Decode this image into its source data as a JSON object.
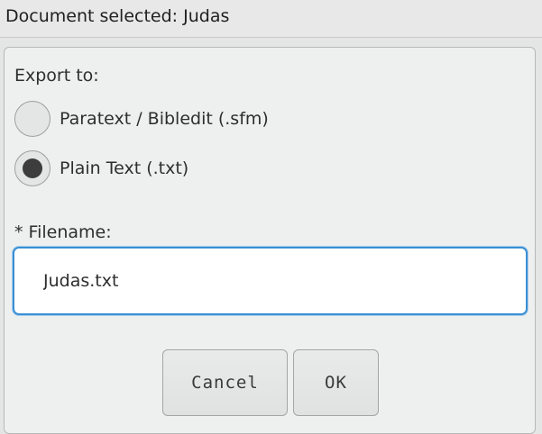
{
  "window": {
    "title": "Document selected: Judas"
  },
  "export": {
    "label": "Export to:",
    "options": [
      {
        "label": "Paratext / Bibledit (.sfm)",
        "selected": false
      },
      {
        "label": "Plain Text (.txt)",
        "selected": true
      }
    ]
  },
  "filename": {
    "label": "* Filename:",
    "value": "Judas.txt"
  },
  "buttons": {
    "cancel_label": "Cancel",
    "ok_label": "OK"
  }
}
